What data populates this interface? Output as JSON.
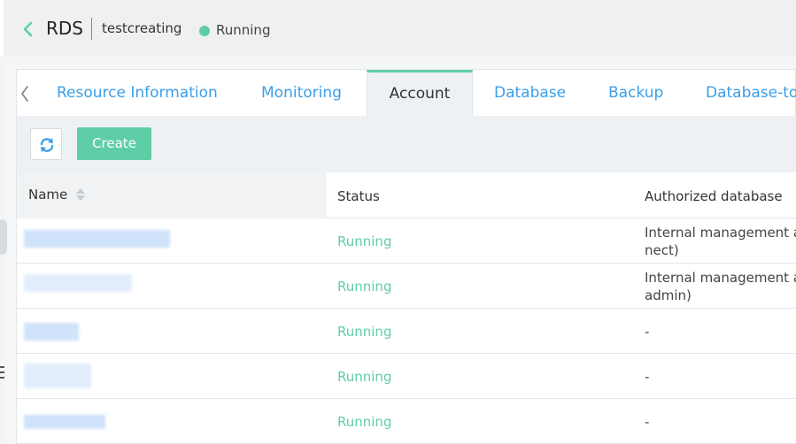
{
  "header": {
    "app_title": "RDS",
    "instance_name": "testcreating",
    "status": "Running",
    "status_color": "#5fcea7"
  },
  "tabs": [
    {
      "label": "Resource Information",
      "active": false
    },
    {
      "label": "Monitoring",
      "active": false
    },
    {
      "label": "Account",
      "active": true
    },
    {
      "label": "Database",
      "active": false
    },
    {
      "label": "Backup",
      "active": false
    },
    {
      "label": "Database-to",
      "active": false
    }
  ],
  "toolbar": {
    "create_label": "Create",
    "accent": "#5fcea7"
  },
  "table": {
    "columns": [
      "Name",
      "Status",
      "Authorized database"
    ],
    "rows": [
      {
        "status": "Running",
        "db_line1": "Internal management ac",
        "db_line2": "nect)"
      },
      {
        "status": "Running",
        "db_line1": "Internal management ac",
        "db_line2": "admin)"
      },
      {
        "status": "Running",
        "db_line1": "-",
        "db_line2": ""
      },
      {
        "status": "Running",
        "db_line1": "-",
        "db_line2": ""
      },
      {
        "status": "Running",
        "db_line1": "-",
        "db_line2": ""
      }
    ]
  },
  "icons": {
    "back": "chevron-left-icon",
    "tab_prev": "chevron-left-icon",
    "refresh": "refresh-icon",
    "sort": "sort-icon"
  },
  "colors": {
    "link": "#3a9ee8",
    "accent": "#5fcea7"
  }
}
